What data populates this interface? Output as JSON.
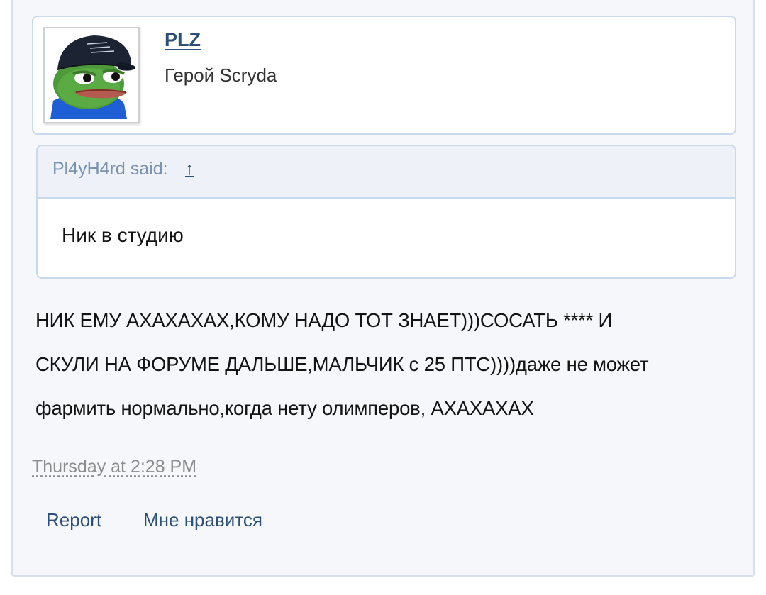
{
  "user": {
    "name": "PLZ",
    "title": "Герой Scryda",
    "avatar_icon": "pepe-frog-cap-avatar"
  },
  "quote": {
    "author": "Pl4yH4rd said:",
    "jump_symbol": "↑",
    "text": "Ник в студию"
  },
  "message": {
    "text": "НИК ЕМУ АХАХАХАХ,КОМУ НАДО ТОТ ЗНАЕТ)))СОСАТЬ **** И\nСКУЛИ НА ФОРУМЕ ДАЛЬШЕ,МАЛЬЧИК с 25 ПТС))))даже не может\nфармить нормально,когда нету олимперов, АХАХАХАХ"
  },
  "meta": {
    "timestamp": "Thursday at 2:28 PM"
  },
  "actions": {
    "report": "Report",
    "like": "Мне нравится"
  },
  "colors": {
    "link": "#2e4f78",
    "quote_author": "#7b92ae",
    "border": "#c9d8ea",
    "post_bg": "#f5f7fb"
  }
}
